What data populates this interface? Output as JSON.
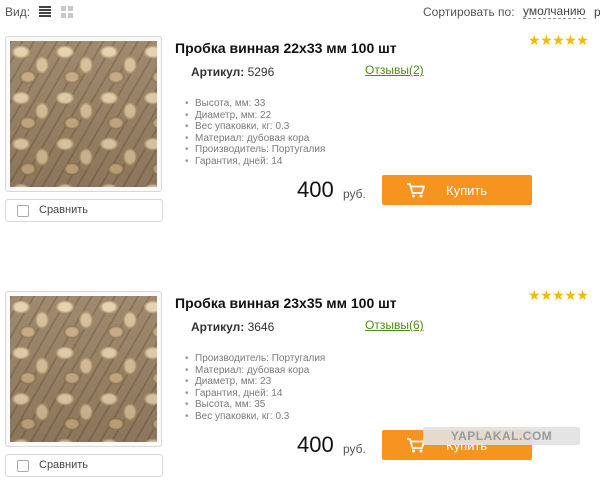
{
  "toolbar": {
    "view_label": "Вид:",
    "sort_label": "Сортировать по:",
    "sort_value": "умолчанию",
    "sort_next": "р"
  },
  "products": [
    {
      "title": "Пробка винная 22x33 мм 100 шт",
      "sku_label": "Артикул:",
      "sku": "5296",
      "reviews": "Отзывы(2)",
      "rating": 5,
      "properties": [
        "Высота, мм: 33",
        "Диаметр, мм: 22",
        "Вес упаковки, кг: 0.3",
        "Материал: дубовая кора",
        "Производитель: Португалия",
        "Гарантия, дней: 14"
      ],
      "price": "400",
      "currency": "руб.",
      "buy_label": "Купить",
      "compare_label": "Сравнить",
      "image_icon": "wine-corks-photo"
    },
    {
      "title": "Пробка винная 23x35 мм 100 шт",
      "sku_label": "Артикул:",
      "sku": "3646",
      "reviews": "Отзывы(6)",
      "rating": 5,
      "properties": [
        "Производитель: Португалия",
        "Материал: дубовая кора",
        "Диаметр, мм: 23",
        "Гарантия, дней: 14",
        "Высота, мм: 35",
        "Вес упаковки, кг: 0.3"
      ],
      "price": "400",
      "currency": "руб.",
      "buy_label": "Купить",
      "compare_label": "Сравнить",
      "image_icon": "wine-corks-photo"
    }
  ],
  "watermark": "YAPLAKAL.COM",
  "colors": {
    "buy_button": "#f79420",
    "stars": "#f6b800",
    "reviews_link": "#4a8a17"
  },
  "icons": {
    "view_list": "list-view-icon",
    "view_grid": "grid-view-icon",
    "cart": "cart-icon",
    "star": "star-icon",
    "checkbox": "checkbox-icon"
  }
}
